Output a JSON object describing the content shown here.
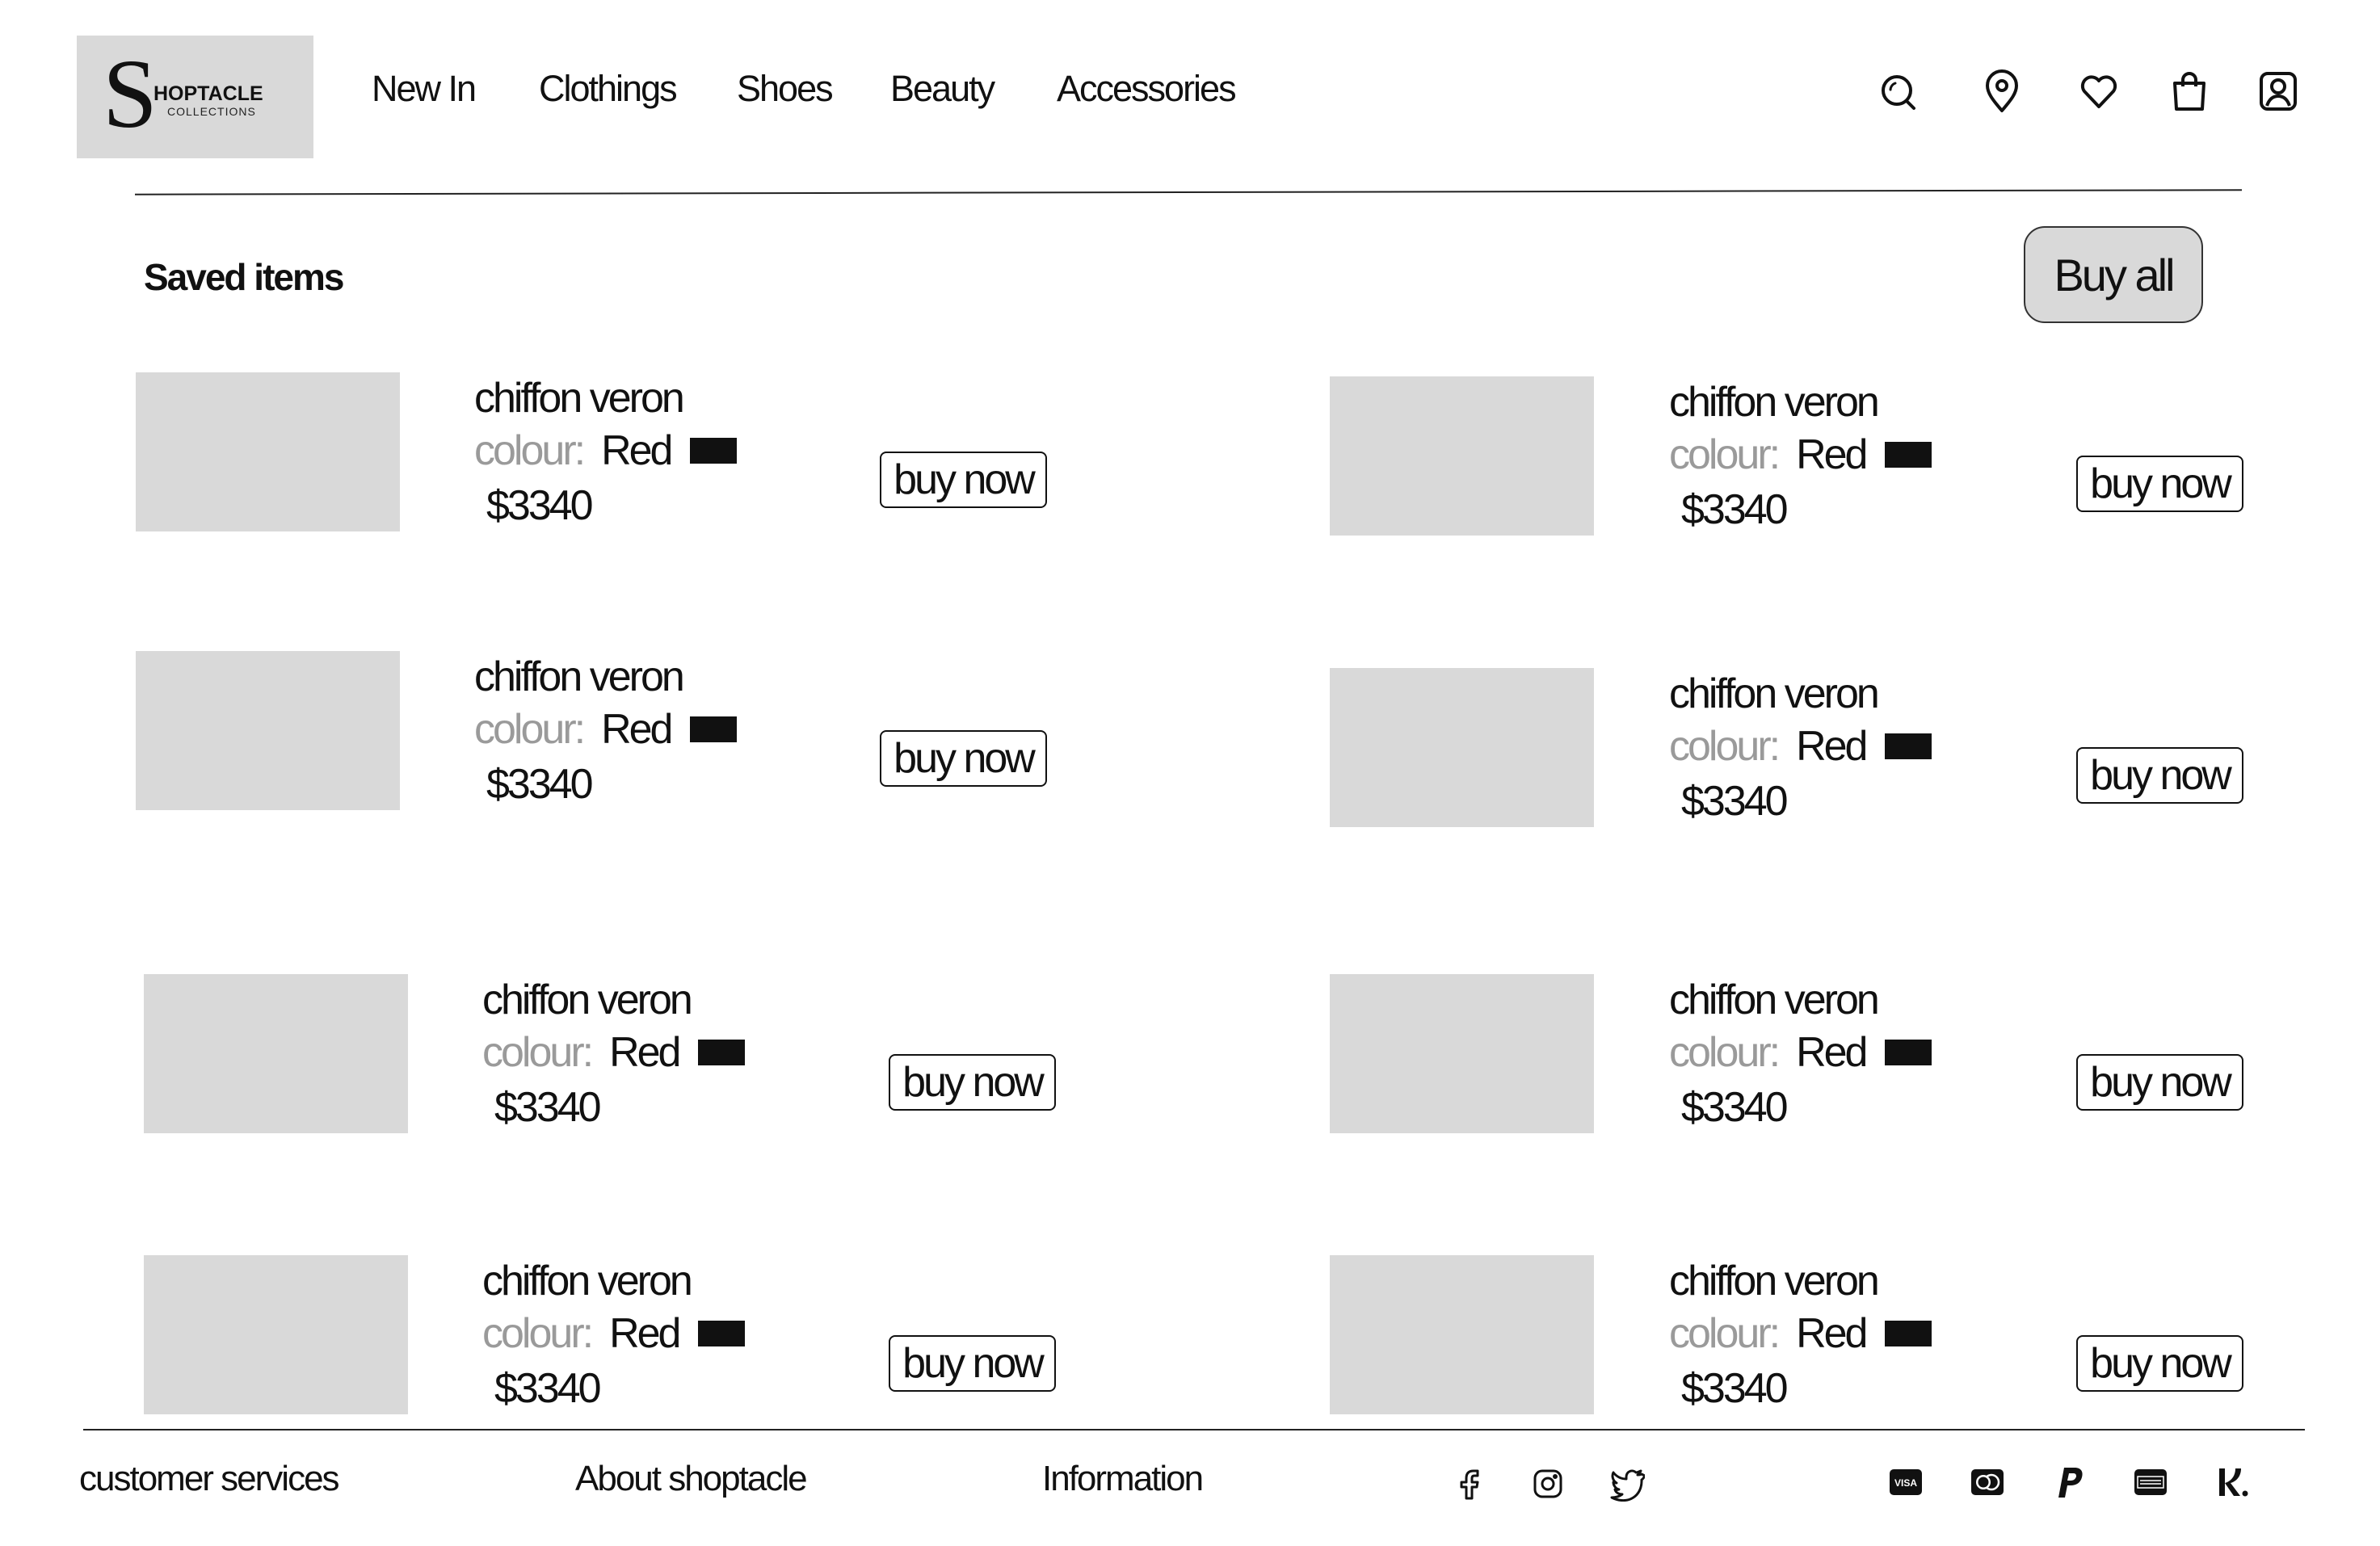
{
  "brand": {
    "initial": "S",
    "name": "HOPTACLE",
    "tagline": "COLLECTIONS"
  },
  "nav": [
    "New In",
    "Clothings",
    "Shoes",
    "Beauty",
    "Accessories"
  ],
  "header_icons": [
    "search-icon",
    "location-pin-icon",
    "heart-icon",
    "shopping-bag-icon",
    "account-icon"
  ],
  "page": {
    "title": "Saved items",
    "buy_all_label": "Buy all"
  },
  "items": [
    {
      "name": "chiffon veron",
      "colour_label": "colour:",
      "colour_value": "Red",
      "price": "$3340",
      "button": "buy now"
    },
    {
      "name": "chiffon veron",
      "colour_label": "colour:",
      "colour_value": "Red",
      "price": "$3340",
      "button": "buy now"
    },
    {
      "name": "chiffon veron",
      "colour_label": "colour:",
      "colour_value": "Red",
      "price": "$3340",
      "button": "buy now"
    },
    {
      "name": "chiffon veron",
      "colour_label": "colour:",
      "colour_value": "Red",
      "price": "$3340",
      "button": "buy now"
    },
    {
      "name": "chiffon veron",
      "colour_label": "colour:",
      "colour_value": "Red",
      "price": "$3340",
      "button": "buy now"
    },
    {
      "name": "chiffon veron",
      "colour_label": "colour:",
      "colour_value": "Red",
      "price": "$3340",
      "button": "buy now"
    },
    {
      "name": "chiffon veron",
      "colour_label": "colour:",
      "colour_value": "Red",
      "price": "$3340",
      "button": "buy now"
    },
    {
      "name": "chiffon veron",
      "colour_label": "colour:",
      "colour_value": "Red",
      "price": "$3340",
      "button": "buy now"
    }
  ],
  "footer": {
    "links": [
      "customer services",
      "About shoptacle",
      "Information"
    ],
    "social_icons": [
      "facebook-icon",
      "instagram-icon",
      "twitter-icon"
    ],
    "payment_icons": [
      "visa-icon",
      "mastercard-icon",
      "paypal-icon",
      "american-express-icon",
      "klarna-icon"
    ]
  },
  "colors": {
    "placeholder": "#d9d9d9",
    "swatch": "#111111",
    "muted_text": "#9a9a9a",
    "text": "#111111"
  }
}
